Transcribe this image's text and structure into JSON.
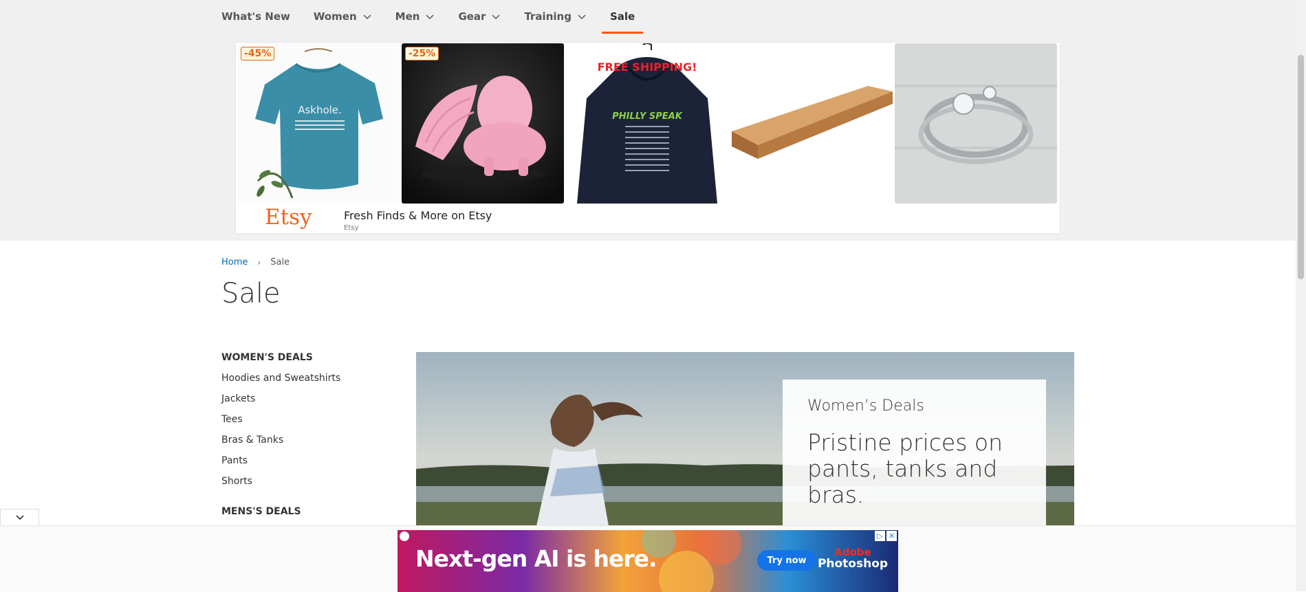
{
  "nav": {
    "items": [
      {
        "label": "What's New"
      },
      {
        "label": "Women"
      },
      {
        "label": "Men"
      },
      {
        "label": "Gear"
      },
      {
        "label": "Training"
      },
      {
        "label": "Sale"
      }
    ]
  },
  "etsy_ad": {
    "tiles": [
      {
        "badge": "-45%",
        "shirt_text": "Askhole.",
        "icon": "tshirt-product-image"
      },
      {
        "badge": "-25%",
        "icon": "pink-shell-figurine-image"
      },
      {
        "banner": "FREE SHIPPING!",
        "hoodie_text": "PHILLY SPEAK",
        "icon": "hoodie-product-image"
      },
      {
        "icon": "wood-shelf-image"
      },
      {
        "icon": "diamond-ring-image"
      }
    ],
    "logo": "Etsy",
    "headline": "Fresh Finds & More on Etsy",
    "sub": "Etsy"
  },
  "breadcrumb": {
    "home": "Home",
    "separator": "›",
    "current": "Sale"
  },
  "page": {
    "title": "Sale"
  },
  "sidebar": {
    "heading": "WOMEN'S DEALS",
    "links": [
      {
        "label": "Hoodies and Sweatshirts"
      },
      {
        "label": "Jackets"
      },
      {
        "label": "Tees"
      },
      {
        "label": "Bras & Tanks"
      },
      {
        "label": "Pants"
      },
      {
        "label": "Shorts"
      }
    ],
    "next_heading": "MENS'S DEALS"
  },
  "hero": {
    "card_title": "Women’s Deals",
    "card_text": "Pristine prices on pants, tanks and bras."
  },
  "bottom_ad": {
    "headline": "Next-gen AI is here.",
    "button": "Try now",
    "brand_line1": "Adobe",
    "brand_line2": "Photoshop"
  },
  "colors": {
    "accent": "#ff5501",
    "link": "#006bb4",
    "etsy_orange": "#f1641e"
  }
}
